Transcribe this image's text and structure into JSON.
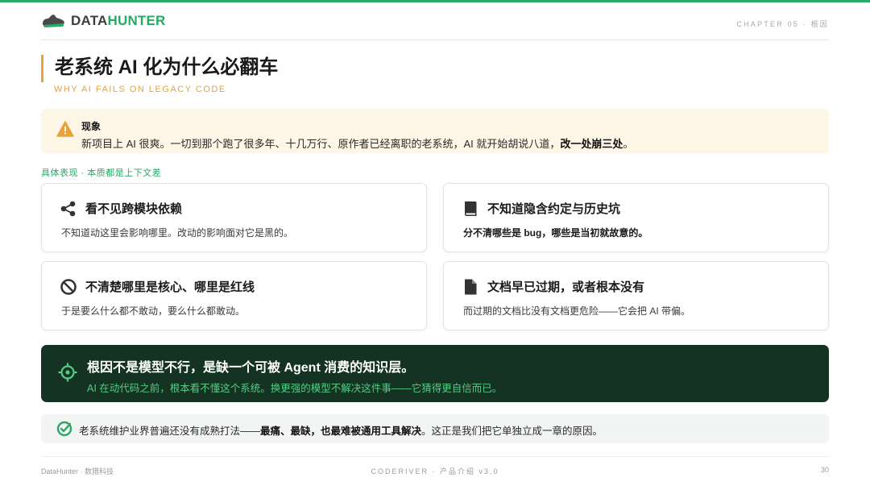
{
  "header": {
    "logo_data": "DATA",
    "logo_hunter": "HUNTER",
    "chapter": "CHAPTER 05 · 根因"
  },
  "title": "老系统 AI 化为什么必翻车",
  "subtitle": "WHY AI FAILS ON LEGACY CODE",
  "notice": {
    "icon": "warning-icon",
    "heading": "现象",
    "text": "新项目上 AI 很爽。一切到那个跑了很多年、十几万行、原作者已经离职的老系统，AI 就开始胡说八道，",
    "emphasis": "改一处崩三处",
    "end": "。"
  },
  "section_label": "具体表现 · 本质都是上下文差",
  "cards": [
    {
      "icon": "share-nodes-icon",
      "title": "看不见跨模块依赖",
      "desc": "不知道动这里会影响哪里。改动的影响面对它是黑的。"
    },
    {
      "icon": "book-icon",
      "title": "不知道隐含约定与历史坑",
      "desc": "分不清哪些是 bug，哪些是当初就故意的。"
    },
    {
      "icon": "prohibited-icon",
      "title": "不清楚哪里是核心、哪里是红线",
      "desc": "于是要么什么都不敢动，要么什么都敢动。"
    },
    {
      "icon": "document-icon",
      "title": "文档早已过期，或者根本没有",
      "desc": "而过期的文档比没有文档更危险——它会把 AI 带偏。"
    }
  ],
  "highlight": {
    "icon": "crosshair-icon",
    "title": "根因不是模型不行，是缺一个可被 Agent 消费的知识层。",
    "text": "AI 在动代码之前，根本看不懂这个系统。换更强的模型不解决这件事——它猜得更自信而已。"
  },
  "footnote": {
    "icon": "check-circle-icon",
    "text": "老系统维护业界普遍还没有成熟打法——",
    "emphasis": "最痛、最缺，也最难被通用工具解决",
    "end": "。这正是我们把它单独立成一章的原因。"
  },
  "footer": {
    "left": "DataHunter · 数猎科技",
    "center": "CODERIVER · 产品介绍 v3.0",
    "page": "30"
  },
  "colors": {
    "brand_green": "#2aa865",
    "accent_orange": "#e8a23a",
    "dark_panel": "#143322",
    "panel_text": "#52cc85"
  }
}
